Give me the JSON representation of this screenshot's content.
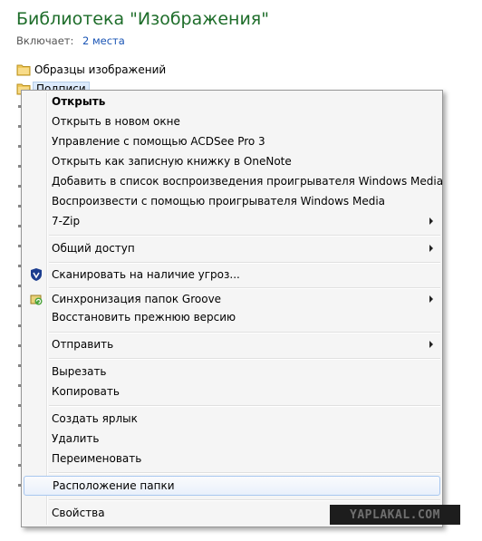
{
  "library": {
    "title": "Библиотека \"Изображения\"",
    "includes_label": "Включает:",
    "includes_link": "2 места"
  },
  "folders": [
    {
      "label": "Образцы изображений"
    },
    {
      "label": "Подписи"
    }
  ],
  "menu": {
    "items": [
      {
        "id": "open",
        "label": "Открыть"
      },
      {
        "id": "open-new-window",
        "label": "Открыть в новом окне"
      },
      {
        "id": "acdsee",
        "label": "Управление с помощью ACDSee Pro 3"
      },
      {
        "id": "onenote",
        "label": "Открыть как записную книжку в OneNote"
      },
      {
        "id": "wmp-add",
        "label": "Добавить в список воспроизведения проигрывателя Windows Media"
      },
      {
        "id": "wmp-play",
        "label": "Воспроизвести с помощью проигрывателя Windows Media"
      },
      {
        "id": "7zip",
        "label": "7-Zip"
      },
      {
        "id": "share",
        "label": "Общий доступ"
      },
      {
        "id": "scan",
        "label": "Сканировать на наличие угроз..."
      },
      {
        "id": "groove",
        "label": "Синхронизация папок Groove"
      },
      {
        "id": "restore",
        "label": "Восстановить прежнюю версию"
      },
      {
        "id": "send-to",
        "label": "Отправить"
      },
      {
        "id": "cut",
        "label": "Вырезать"
      },
      {
        "id": "copy",
        "label": "Копировать"
      },
      {
        "id": "shortcut",
        "label": "Создать ярлык"
      },
      {
        "id": "delete",
        "label": "Удалить"
      },
      {
        "id": "rename",
        "label": "Переименовать"
      },
      {
        "id": "folder-location",
        "label": "Расположение папки"
      },
      {
        "id": "properties",
        "label": "Свойства"
      }
    ],
    "hovered": "Расположение папки"
  },
  "icons": {
    "scan": "shield-icon",
    "groove": "groove-sync-icon",
    "folder": "folder-icon",
    "submenu": "submenu-arrow-icon"
  },
  "colors": {
    "title_green": "#1e6d2a",
    "link_blue": "#1a55b5",
    "menu_bg": "#f5f5f5",
    "hover_border": "#a8c7ef"
  },
  "watermark": "YAPLAKAL.COM"
}
